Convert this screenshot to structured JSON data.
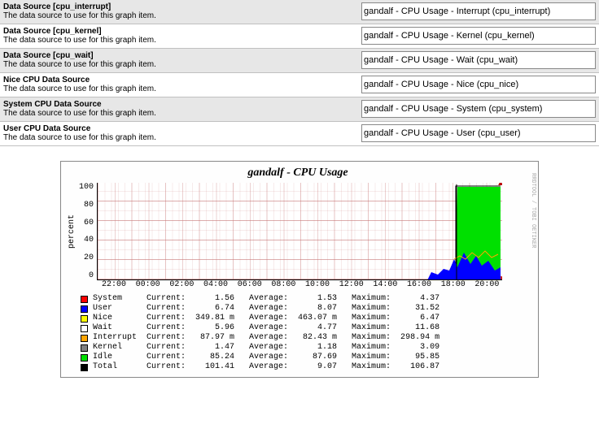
{
  "rows": [
    {
      "label": "Data Source [cpu_interrupt]",
      "desc": "The data source to use for this graph item.",
      "value": "gandalf - CPU Usage - Interrupt (cpu_interrupt)"
    },
    {
      "label": "Data Source [cpu_kernel]",
      "desc": "The data source to use for this graph item.",
      "value": "gandalf - CPU Usage - Kernel (cpu_kernel)"
    },
    {
      "label": "Data Source [cpu_wait]",
      "desc": "The data source to use for this graph item.",
      "value": "gandalf - CPU Usage - Wait (cpu_wait)"
    },
    {
      "label": "Nice CPU Data Source",
      "desc": "The data source to use for this graph item.",
      "value": "gandalf - CPU Usage - Nice (cpu_nice)"
    },
    {
      "label": "System CPU Data Source",
      "desc": "The data source to use for this graph item.",
      "value": "gandalf - CPU Usage - System (cpu_system)"
    },
    {
      "label": "User CPU Data Source",
      "desc": "The data source to use for this graph item.",
      "value": "gandalf - CPU Usage - User (cpu_user)"
    }
  ],
  "chart_data": {
    "type": "area",
    "title": "gandalf - CPU Usage",
    "ylabel": "percent",
    "ylim": [
      0,
      100
    ],
    "yticks": [
      0,
      20,
      40,
      60,
      80,
      100
    ],
    "xticks": [
      "22:00",
      "00:00",
      "02:00",
      "04:00",
      "06:00",
      "08:00",
      "10:00",
      "12:00",
      "14:00",
      "16:00",
      "18:00",
      "20:00"
    ],
    "credit": "RRDTOOL / TOBI OETIKER",
    "series": [
      {
        "name": "System",
        "color": "#ff0000",
        "current": "1.56",
        "average": "1.53",
        "maximum": "4.37"
      },
      {
        "name": "User",
        "color": "#0000ff",
        "current": "6.74",
        "average": "8.07",
        "maximum": "31.52"
      },
      {
        "name": "Nice",
        "color": "#ffff00",
        "current": "349.81 m",
        "average": "463.07 m",
        "maximum": "6.47"
      },
      {
        "name": "Wait",
        "color": "#ffffff",
        "current": "5.96",
        "average": "4.77",
        "maximum": "11.68"
      },
      {
        "name": "Interrupt",
        "color": "#ffa500",
        "current": "87.97 m",
        "average": "82.43 m",
        "maximum": "298.94 m"
      },
      {
        "name": "Kernel",
        "color": "#808080",
        "current": "1.47",
        "average": "1.18",
        "maximum": "3.09"
      },
      {
        "name": "Idle",
        "color": "#00e000",
        "current": "85.24",
        "average": "87.69",
        "maximum": "95.85"
      },
      {
        "name": "Total",
        "color": "#000000",
        "current": "101.41",
        "average": "9.07",
        "maximum": "106.87"
      }
    ],
    "legend_header": {
      "cur": "Current:",
      "avg": "Average:",
      "max": "Maximum:"
    }
  }
}
